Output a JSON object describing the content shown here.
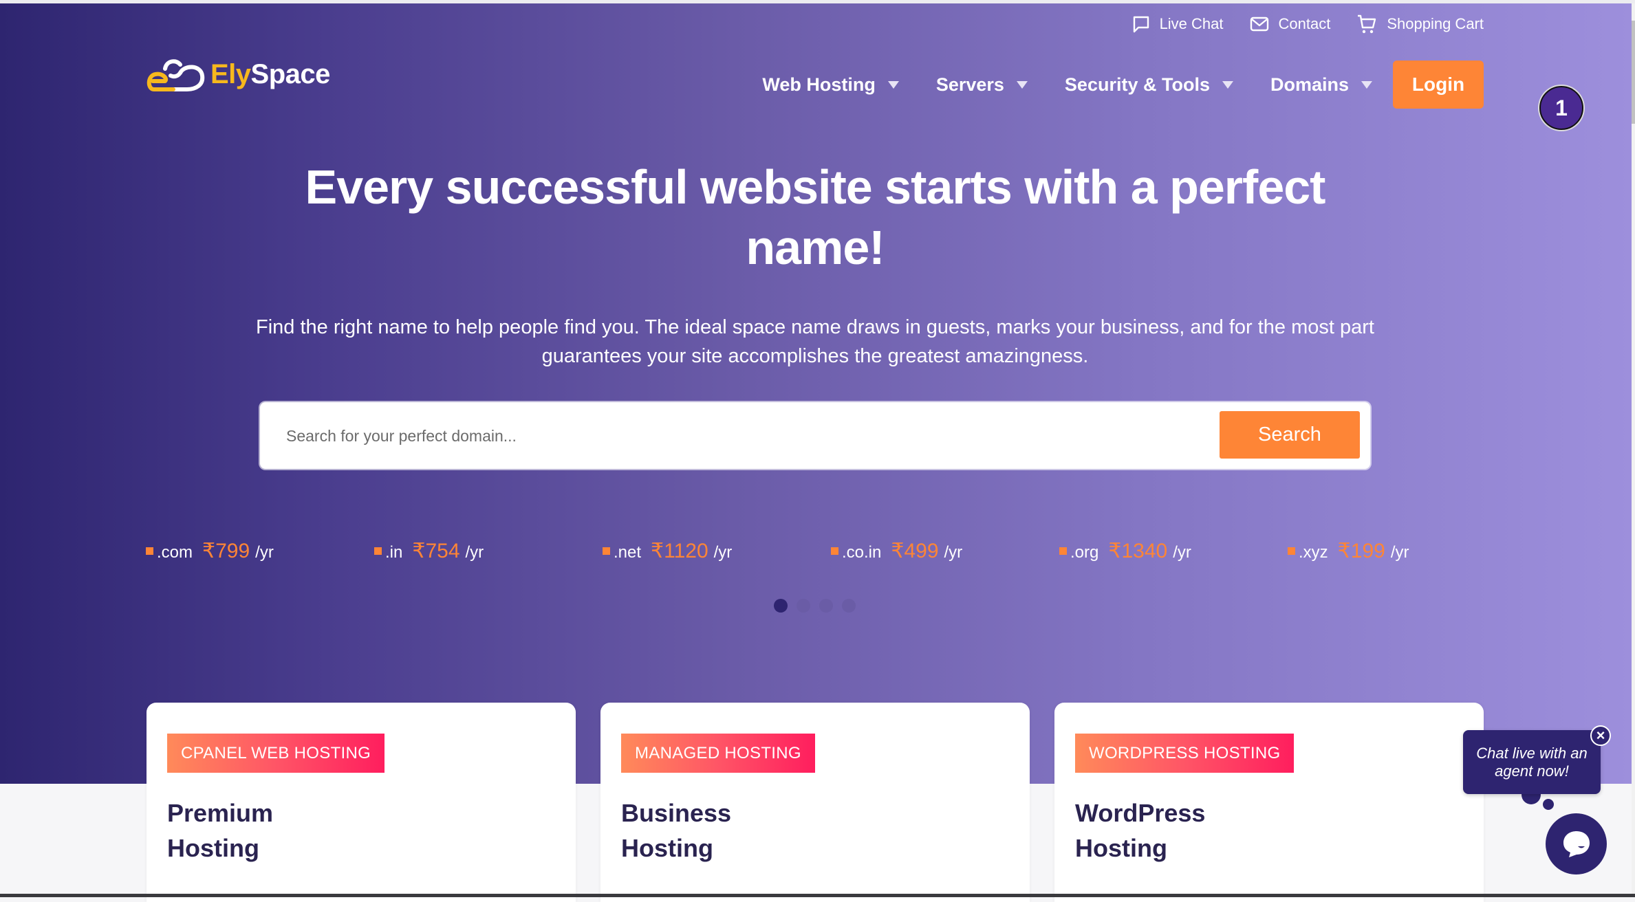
{
  "utility_bar": {
    "items": [
      {
        "label": "Live Chat",
        "icon": "chat-bubble-icon"
      },
      {
        "label": "Contact",
        "icon": "envelope-icon"
      },
      {
        "label": "Shopping Cart",
        "icon": "cart-icon"
      }
    ]
  },
  "logo": {
    "part1": "Ely",
    "part2": "Space"
  },
  "nav": {
    "items": [
      {
        "label": "Web Hosting"
      },
      {
        "label": "Servers"
      },
      {
        "label": "Security & Tools"
      },
      {
        "label": "Domains"
      }
    ],
    "login_label": "Login"
  },
  "badge": {
    "count": "1"
  },
  "hero": {
    "title": "Every successful website starts with a perfect name!",
    "subtitle": "Find the right name to help people find you. The ideal space name draws in guests, marks your business, and for the most part guarantees your site accomplishes the greatest amazingness."
  },
  "search": {
    "placeholder": "Search for your perfect domain...",
    "value": "",
    "button_label": "Search"
  },
  "domains": [
    {
      "ext": ".com",
      "price": "₹799",
      "per": "/yr"
    },
    {
      "ext": ".in",
      "price": "₹754",
      "per": "/yr"
    },
    {
      "ext": ".net",
      "price": "₹1120",
      "per": "/yr"
    },
    {
      "ext": ".co.in",
      "price": "₹499",
      "per": "/yr"
    },
    {
      "ext": ".org",
      "price": "₹1340",
      "per": "/yr"
    },
    {
      "ext": ".xyz",
      "price": "₹199",
      "per": "/yr"
    }
  ],
  "carousel": {
    "total_dots": 4,
    "active_index": 0
  },
  "cards": [
    {
      "tag": "CPANEL WEB HOSTING",
      "title": "Premium Hosting"
    },
    {
      "tag": "MANAGED HOSTING",
      "title": "Business Hosting"
    },
    {
      "tag": "WORDPRESS HOSTING",
      "title": "WordPress Hosting"
    }
  ],
  "chat_widget": {
    "bubble_text": "Chat live with an agent now!",
    "close_symbol": "×"
  },
  "colors": {
    "accent_orange": "#fe8536",
    "brand_indigo": "#2e2470",
    "logo_yellow": "#f7b81d",
    "tag_gradient_start": "#ff8a5a",
    "tag_gradient_end": "#ff1e5e"
  }
}
